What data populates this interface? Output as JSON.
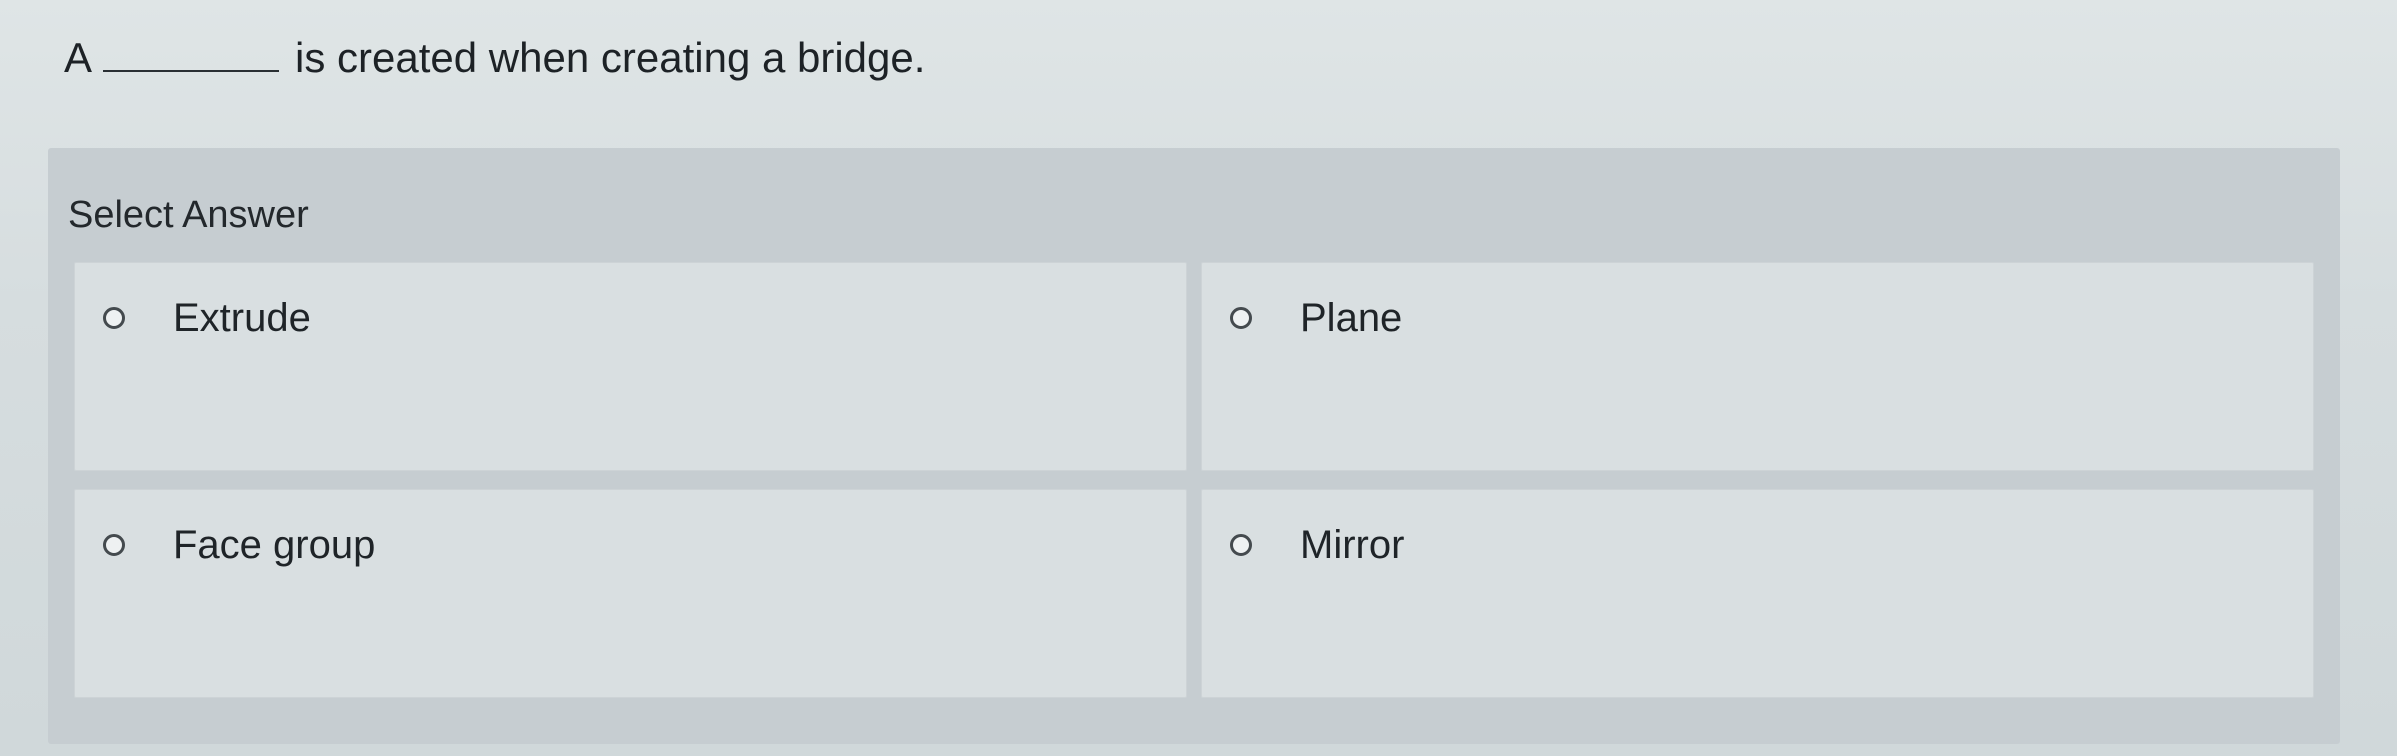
{
  "question": {
    "prefix": "A",
    "suffix": "is created when creating a bridge."
  },
  "answers": {
    "heading": "Select Answer",
    "options": [
      {
        "label": "Extrude",
        "selected": false
      },
      {
        "label": "Plane",
        "selected": false
      },
      {
        "label": "Face group",
        "selected": false
      },
      {
        "label": "Mirror",
        "selected": false
      }
    ]
  }
}
